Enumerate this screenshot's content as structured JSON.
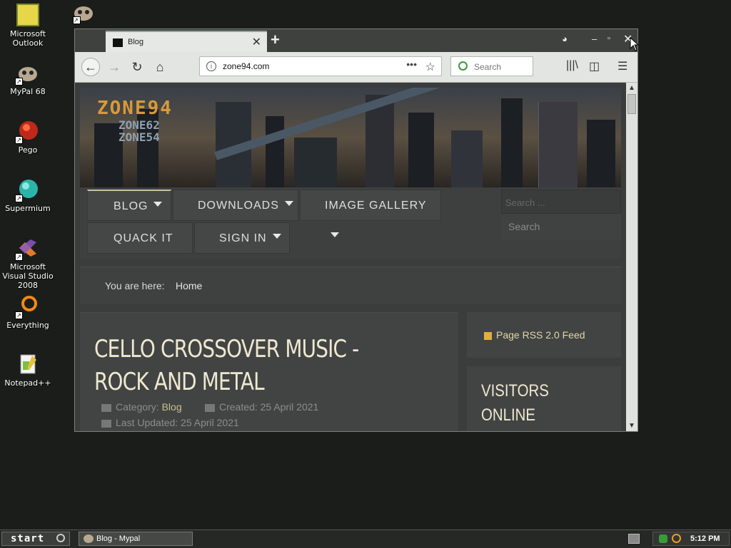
{
  "desktop": {
    "icons": [
      {
        "label": "Microsoft Outlook",
        "icon": "outlook-icon"
      },
      {
        "label": "MyPal 68",
        "icon": "mypal-icon"
      },
      {
        "label": "Pego",
        "icon": "pego-icon"
      },
      {
        "label": "Supermium",
        "icon": "supermium-icon"
      },
      {
        "label": "Microsoft Visual Studio 2008",
        "icon": "visual-studio-icon"
      },
      {
        "label": "Everything",
        "icon": "everything-icon"
      },
      {
        "label": "Notepad++",
        "icon": "notepadpp-icon"
      }
    ]
  },
  "browser": {
    "tab_title": "Blog",
    "url": "zone94.com",
    "search_placeholder": "Search"
  },
  "page": {
    "logo_main": "ZONE94",
    "logo_sub1": "ZONE62",
    "logo_sub2": "ZONE54",
    "menu": {
      "blog": "BLOG",
      "downloads": "DOWNLOADS",
      "image_gallery": "IMAGE GALLERY",
      "quack_it": "QUACK IT",
      "sign_in": "SIGN IN"
    },
    "search_placeholder": "Search ...",
    "search_button": "Search",
    "breadcrumb_label": "You are here:",
    "breadcrumb_home": "Home",
    "article": {
      "title": "CELLO CROSSOVER MUSIC - ROCK AND METAL",
      "category_label": "Category:",
      "category_value": "Blog",
      "created": "Created: 25 April 2021",
      "updated": "Last Updated: 25 April 2021"
    },
    "rss_link": "Page RSS 2.0 Feed",
    "visitors_heading": "VISITORS ONLINE"
  },
  "taskbar": {
    "start_label": "start",
    "task_label": "Blog - Mypal",
    "clock": "5:12 PM"
  },
  "colors": {
    "accent_text": "#c9c090",
    "heading": "#efe8d0",
    "desktop_bg": "#1b1d1b"
  }
}
